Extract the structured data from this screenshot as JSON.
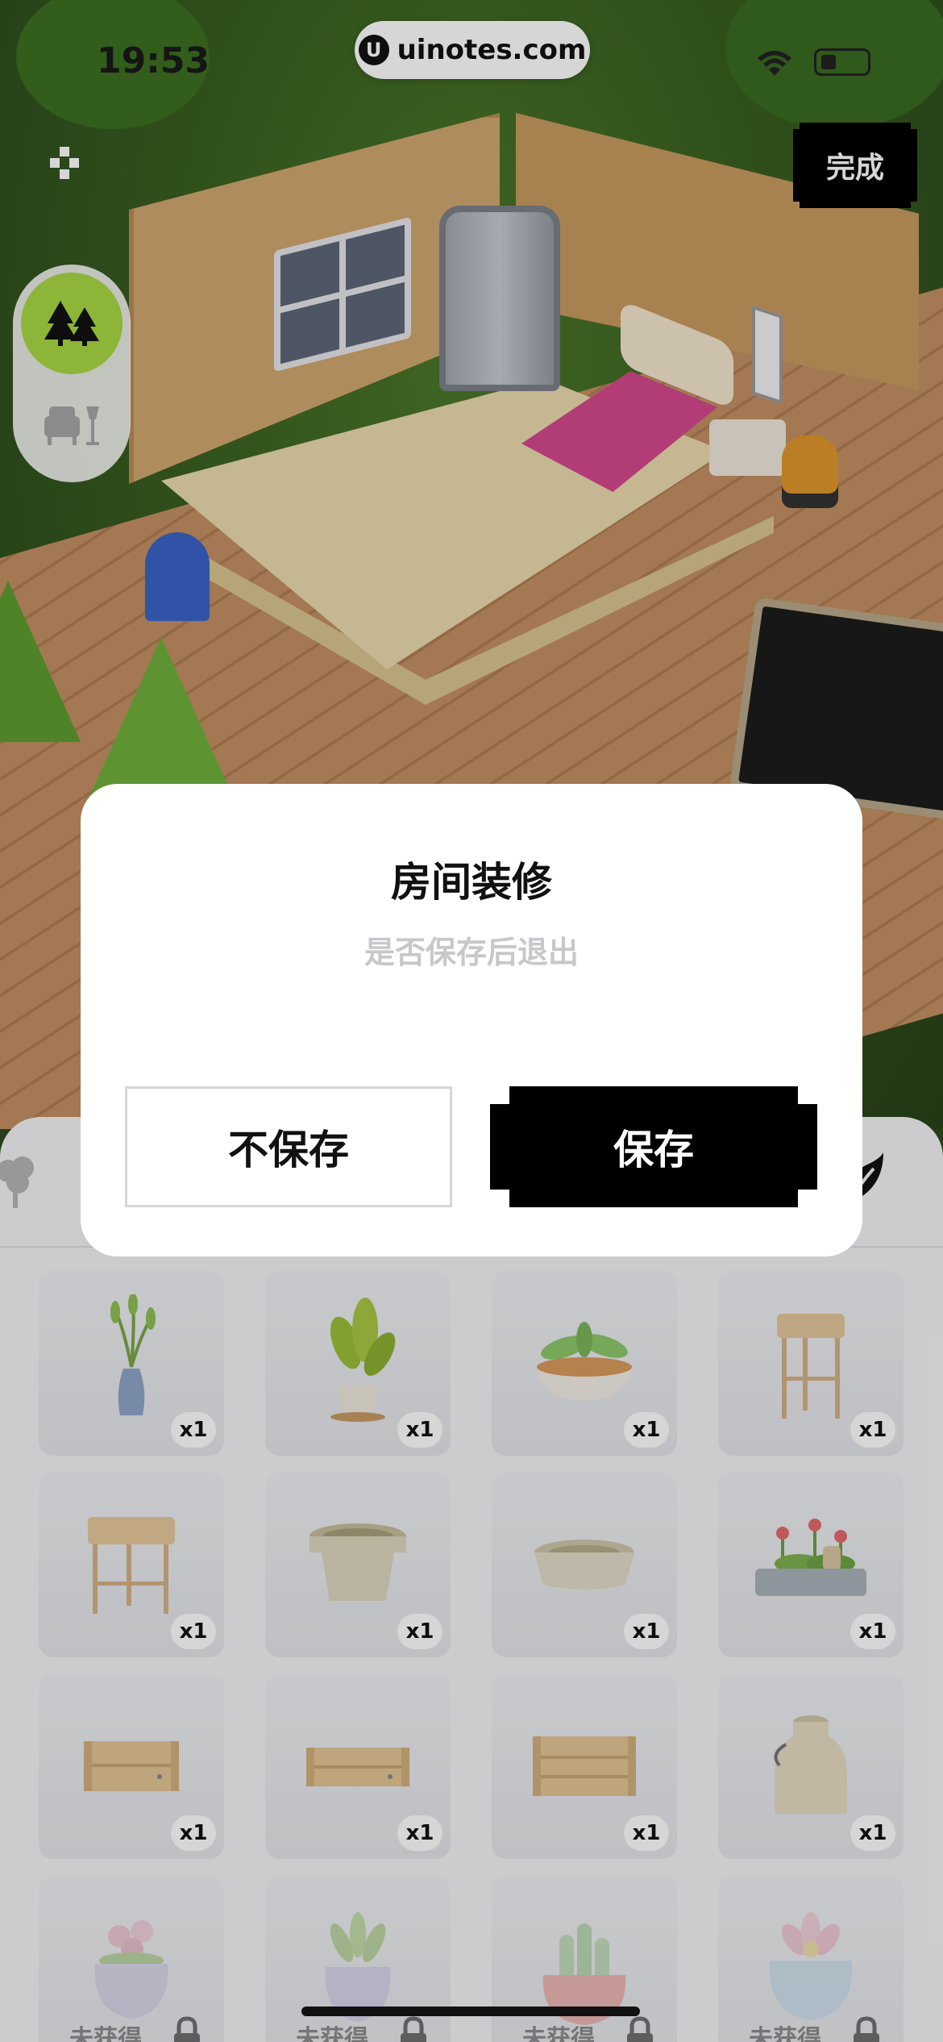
{
  "status_bar": {
    "time": "19:53",
    "site_label": "uinotes.com"
  },
  "top_bar": {
    "done_label": "完成"
  },
  "side_toggle": {
    "top_icon": "trees-icon",
    "bottom_icon": "furniture-icon",
    "selected": "top"
  },
  "dialog": {
    "title": "房间装修",
    "subtitle": "是否保存后退出",
    "cancel_label": "不保存",
    "confirm_label": "保存"
  },
  "inventory": {
    "tabs": [
      "tree-tab-icon",
      "leaf-tab-icon"
    ],
    "items": [
      {
        "name": "vase-plant",
        "qty": "x1",
        "locked": false
      },
      {
        "name": "potted-plant",
        "qty": "x1",
        "locked": false
      },
      {
        "name": "bowl-plant",
        "qty": "x1",
        "locked": false
      },
      {
        "name": "plant-stand",
        "qty": "x1",
        "locked": false
      },
      {
        "name": "wooden-stand",
        "qty": "x1",
        "locked": false
      },
      {
        "name": "clay-pot",
        "qty": "x1",
        "locked": false
      },
      {
        "name": "shallow-pot",
        "qty": "x1",
        "locked": false
      },
      {
        "name": "flower-planter",
        "qty": "x1",
        "locked": false
      },
      {
        "name": "wooden-crate-1",
        "qty": "x1",
        "locked": false
      },
      {
        "name": "wooden-crate-2",
        "qty": "x1",
        "locked": false
      },
      {
        "name": "wooden-crate-3",
        "qty": "x1",
        "locked": false
      },
      {
        "name": "milk-can",
        "qty": "x1",
        "locked": false
      },
      {
        "name": "flower-pot-locked",
        "status": "未获得",
        "locked": true
      },
      {
        "name": "succulent-pot-locked",
        "status": "未获得",
        "locked": true
      },
      {
        "name": "cactus-pot-locked",
        "status": "未获得",
        "locked": true
      },
      {
        "name": "lotus-pot-locked",
        "status": "未获得",
        "locked": true
      }
    ]
  },
  "colors": {
    "accent_green": "#a9d843",
    "button_black": "#000000",
    "panel_bg": "#f4f4f6"
  }
}
